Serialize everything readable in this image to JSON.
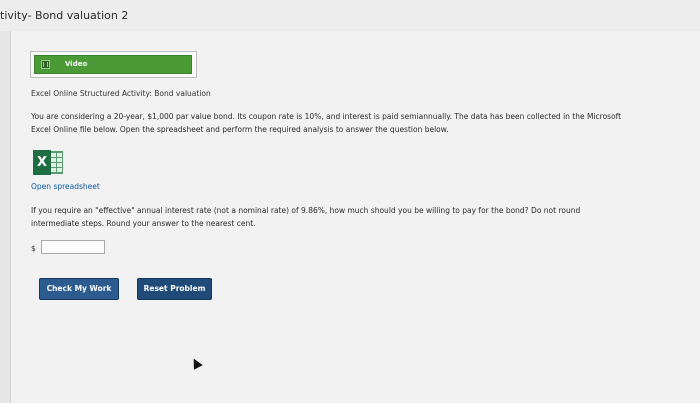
{
  "window": {
    "title": "tivity- Bond valuation 2"
  },
  "video": {
    "label": "Video"
  },
  "activity": {
    "title": "Excel Online Structured Activity: Bond valuation"
  },
  "paragraph": {
    "line1": "You are considering a 20-year, $1,000 par value bond. Its coupon rate is 10%, and interest is paid semiannually. The data has been collected in the Microsoft",
    "line2": "Excel Online file below. Open the spreadsheet and perform the required analysis to answer the question below."
  },
  "excel": {
    "icon": "excel-icon",
    "letter": "X"
  },
  "link": {
    "open_spreadsheet": "Open spreadsheet"
  },
  "question": {
    "line1": "If you require an \"effective\" annual interest rate (not a nominal rate) of 9.86%, how much should you be willing to pay for the bond? Do not round",
    "line2": "intermediate steps. Round your answer to the nearest cent."
  },
  "answer": {
    "currency": "$",
    "value": ""
  },
  "buttons": {
    "check": "Check My Work",
    "reset": "Reset Problem"
  },
  "colors": {
    "video_green": "#4a9a36",
    "button_blue": "#2b5b8f",
    "link_blue": "#0b57a0",
    "excel_green": "#1f6e43"
  }
}
